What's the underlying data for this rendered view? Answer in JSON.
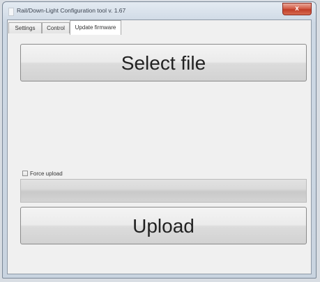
{
  "window": {
    "title": "Rail/Down-Light Configuration tool v. 1.67",
    "close_glyph": "x"
  },
  "tabs": [
    {
      "label": "Settings",
      "active": false
    },
    {
      "label": "Control",
      "active": false
    },
    {
      "label": "Update firmware",
      "active": true
    }
  ],
  "firmware": {
    "select_file_label": "Select file",
    "force_upload_label": "Force upload",
    "force_upload_checked": false,
    "upload_progress_fraction": 0,
    "upload_label": "Upload"
  },
  "icons": {
    "app": "app-icon",
    "close": "close-icon"
  },
  "colors": {
    "close_button": "#c13e28",
    "window_frame": "#c9d4e0",
    "panel": "#f0f0f0"
  }
}
